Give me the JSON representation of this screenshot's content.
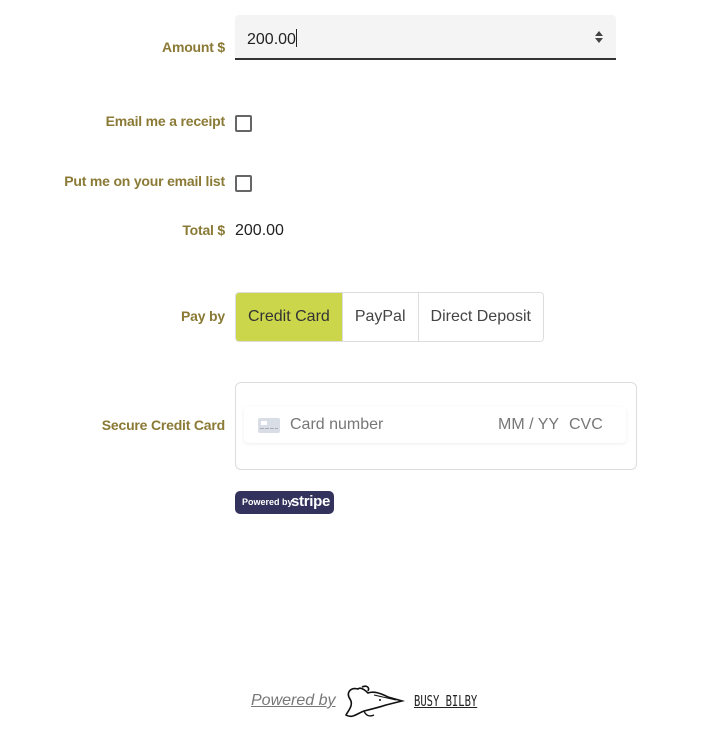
{
  "form": {
    "amount": {
      "label": "Amount $",
      "value": "200.00"
    },
    "email_receipt": {
      "label": "Email me a receipt",
      "checked": false
    },
    "email_list": {
      "label": "Put me on your email list",
      "checked": false
    },
    "total": {
      "label": "Total $",
      "value": "200.00"
    },
    "pay_by": {
      "label": "Pay by",
      "options": [
        "Credit Card",
        "PayPal",
        "Direct Deposit"
      ],
      "selected": "Credit Card"
    },
    "credit_card": {
      "label": "Secure Credit Card",
      "card_number_placeholder": "Card number",
      "expiry_placeholder": "MM / YY",
      "cvc_placeholder": "CVC"
    },
    "stripe_badge": {
      "powered_by": "Powered by",
      "brand": "stripe"
    }
  },
  "footer": {
    "powered_by": "Powered by",
    "brand": "BUSY BILBY"
  },
  "colors": {
    "label": "#8a7a35",
    "selected_payment": "#cbd64a",
    "stripe_badge": "#32325d"
  }
}
